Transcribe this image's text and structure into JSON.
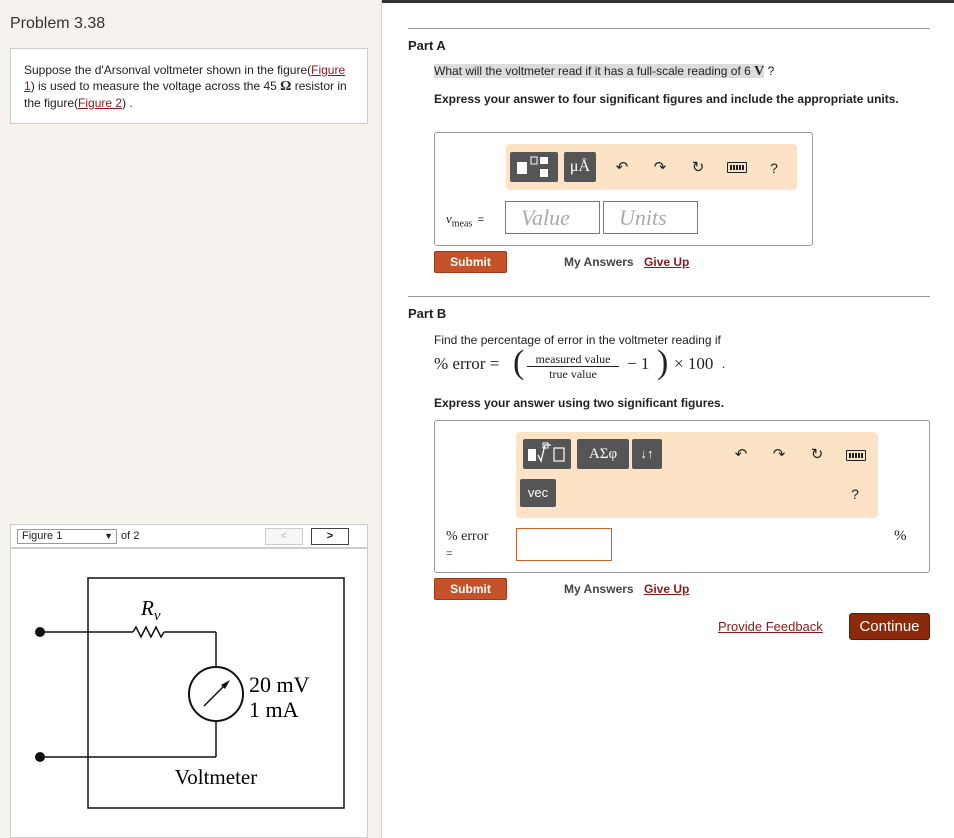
{
  "problem": {
    "title": "Problem 3.38",
    "text_1": "Suppose the d'Arsonval voltmeter shown in the figure(",
    "figure1_link": "Figure 1",
    "text_2": ") is used to measure the voltage across the 45 ",
    "omega": "Ω",
    "text_3": " resistor in the figure(",
    "figure2_link": "Figure 2",
    "text_4": ") ."
  },
  "figure_nav": {
    "selected": "Figure 1",
    "of": "of 2",
    "prev": "<",
    "next": ">"
  },
  "figure": {
    "resistor_symbol": "R",
    "resistor_sub": "v",
    "meter_rating_1": "20 mV",
    "meter_rating_2": "1 mA",
    "caption": "Voltmeter"
  },
  "part_a": {
    "title": "Part A",
    "question": "What will the voltmeter read if it has a full-scale reading of 6 ",
    "unit": "V",
    "question_end": " ?",
    "instruction": "Express your answer to four significant figures and include the appropriate units.",
    "toolbar_units": "μÅ",
    "help": "?",
    "var_name": "v",
    "var_sub": "meas",
    "equals": "=",
    "value_placeholder": "Value",
    "units_placeholder": "Units",
    "submit": "Submit",
    "my_answers": "My Answers",
    "give_up": "Give Up"
  },
  "part_b": {
    "title": "Part B",
    "question": "Find the percentage of error in the voltmeter reading if",
    "formula_lhs": "% error =",
    "frac_num": "measured value",
    "frac_den": "true value",
    "formula_minus": "− 1",
    "formula_times": "× 100",
    "formula_dot": ".",
    "instruction": "Express your answer using two significant figures.",
    "toolbar_greek": "ΑΣφ",
    "toolbar_arrows": "↓↑",
    "toolbar_vec": "vec",
    "help": "?",
    "label": "% error",
    "equals": "=",
    "unit": "%",
    "submit": "Submit",
    "my_answers": "My Answers",
    "give_up": "Give Up"
  },
  "footer": {
    "feedback": "Provide Feedback",
    "continue": "Continue"
  }
}
